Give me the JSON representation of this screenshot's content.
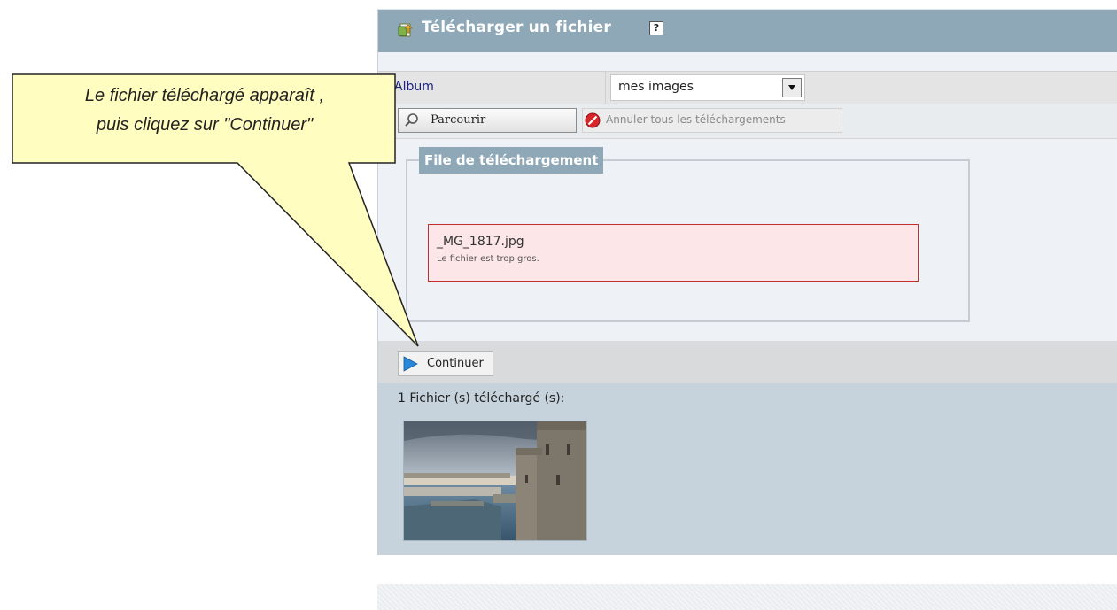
{
  "header": {
    "title": "Télécharger un fichier",
    "help_label": "?"
  },
  "album": {
    "label": "Album",
    "selected": "mes images"
  },
  "toolbar": {
    "browse_label": "Parcourir",
    "cancel_all_label": "Annuler tous les téléchargements"
  },
  "queue": {
    "legend": "File de téléchargement",
    "items": [
      {
        "filename": "_MG_1817.jpg",
        "error": "Le fichier est trop gros."
      }
    ]
  },
  "actions": {
    "continue_label": "Continuer"
  },
  "uploaded": {
    "title": "1 Fichier (s) téléchargé (s):"
  },
  "callout": {
    "line1": "Le fichier téléchargé apparaît ,",
    "line2": "puis cliquez sur \"Continuer\""
  },
  "colors": {
    "header_bg": "#8fa8b8",
    "callout_fill": "#fffdc0",
    "error_border": "#c03030",
    "error_bg": "#fde6e7",
    "uploaded_bg": "#c7d3dc"
  }
}
